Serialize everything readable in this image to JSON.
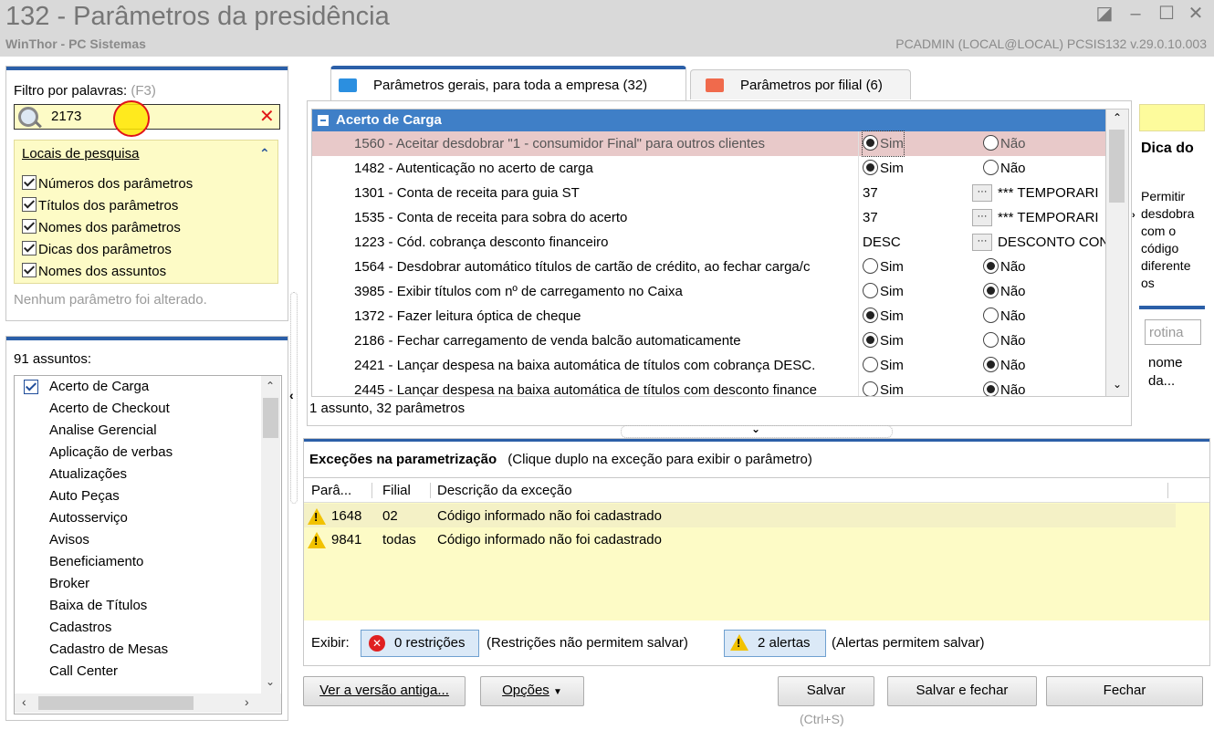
{
  "window": {
    "title": "132 - Parâmetros da presidência",
    "subtitle": "WinThor - PC Sistemas",
    "user_info": "PCADMIN (LOCAL@LOCAL)   PCSIS132  v.29.0.10.003"
  },
  "filter": {
    "label": "Filtro por palavras:",
    "shortcut": "(F3)",
    "value": "2173",
    "locations_title": "Locais de pesquisa",
    "locations": [
      {
        "label": "Números dos parâmetros",
        "checked": true
      },
      {
        "label": "Títulos dos parâmetros",
        "checked": true
      },
      {
        "label": "Nomes dos parâmetros",
        "checked": true
      },
      {
        "label": "Dicas dos parâmetros",
        "checked": true
      },
      {
        "label": "Nomes dos assuntos",
        "checked": true
      }
    ],
    "status": "Nenhum parâmetro foi alterado."
  },
  "subjects": {
    "count_label": "91 assuntos:",
    "items": [
      {
        "label": "Acerto de Carga",
        "checked": true
      },
      {
        "label": "Acerto de Checkout",
        "checked": false
      },
      {
        "label": "Analise Gerencial",
        "checked": false
      },
      {
        "label": "Aplicação de verbas",
        "checked": false
      },
      {
        "label": "Atualizações",
        "checked": false
      },
      {
        "label": "Auto Peças",
        "checked": false
      },
      {
        "label": "Autosserviço",
        "checked": false
      },
      {
        "label": "Avisos",
        "checked": false
      },
      {
        "label": "Beneficiamento",
        "checked": false
      },
      {
        "label": "Broker",
        "checked": false
      },
      {
        "label": "Baixa de Títulos",
        "checked": false
      },
      {
        "label": "Cadastros",
        "checked": false
      },
      {
        "label": "Cadastro de Mesas",
        "checked": false
      },
      {
        "label": "Call Center",
        "checked": false
      }
    ]
  },
  "tabs": [
    {
      "label": "Parâmetros gerais, para toda a empresa",
      "count": "(32)",
      "active": true
    },
    {
      "label": "Parâmetros por filial",
      "count": "(6)",
      "active": false
    }
  ],
  "group_title": "Acerto de Carga",
  "params": [
    {
      "text": "1560 - Aceitar desdobrar \"1 - consumidor Final\" para outros clientes",
      "type": "radio",
      "value": "Sim",
      "highlight": true
    },
    {
      "text": "1482 - Autenticação no acerto de carga",
      "type": "radio",
      "value": "Sim"
    },
    {
      "text": "1301 - Conta de receita para guia ST",
      "type": "lookup",
      "code": "37",
      "desc": "*** TEMPORARI"
    },
    {
      "text": "1535 - Conta de receita para sobra do acerto",
      "type": "lookup",
      "code": "37",
      "desc": "*** TEMPORARI"
    },
    {
      "text": "1223 - Cód. cobrança desconto financeiro",
      "type": "lookup",
      "code": "DESC",
      "desc": "DESCONTO CON"
    },
    {
      "text": "1564 - Desdobrar automático títulos de cartão de crédito, ao fechar carga/c",
      "type": "radio",
      "value": "Não"
    },
    {
      "text": "3985 - Exibir títulos com nº de carregamento no Caixa",
      "type": "radio",
      "value": "Não"
    },
    {
      "text": "1372 - Fazer leitura óptica de cheque",
      "type": "radio",
      "value": "Sim"
    },
    {
      "text": "2186 - Fechar carregamento de venda balcão automaticamente",
      "type": "radio",
      "value": "Sim"
    },
    {
      "text": "2421 - Lançar despesa na baixa automática de títulos com cobrança DESC.",
      "type": "radio",
      "value": "Não"
    },
    {
      "text": "2445 - Lançar despesa na baixa automática de títulos com desconto finance",
      "type": "radio",
      "value": "Não"
    }
  ],
  "radio_labels": {
    "yes": "Sim",
    "no": "Não"
  },
  "params_summary": "1 assunto, 32 parâmetros",
  "tip": {
    "title": "Dica do",
    "text": "Permitir desdobra com o código diferente os",
    "search_placeholder": "rotina",
    "search_hint": "nome da..."
  },
  "exceptions": {
    "title": "Exceções na parametrização",
    "hint": "(Clique duplo na exceção para exibir o parâmetro)",
    "columns": [
      "Parâ...",
      "Filial",
      "Descrição da exceção"
    ],
    "rows": [
      {
        "param": "1648",
        "filial": "02",
        "desc": "Código informado não foi cadastrado"
      },
      {
        "param": "9841",
        "filial": "todas",
        "desc": "Código informado não foi cadastrado"
      }
    ],
    "show_label": "Exibir:",
    "restrictions_btn": "0 restrições",
    "restrictions_note": "(Restrições não permitem salvar)",
    "alerts_btn": "2 alertas",
    "alerts_note": "(Alertas permitem salvar)"
  },
  "footer": {
    "old_version": "Ver a versão antiga...",
    "options": "Opções",
    "save": "Salvar",
    "save_shortcut": "(Ctrl+S)",
    "save_close": "Salvar e fechar",
    "close": "Fechar"
  },
  "colors": {
    "accent": "#2b5fa8",
    "group_header": "#3f7fc7",
    "yellow_panel": "#fdfbc6",
    "cursor_highlight": "#ffe600"
  }
}
